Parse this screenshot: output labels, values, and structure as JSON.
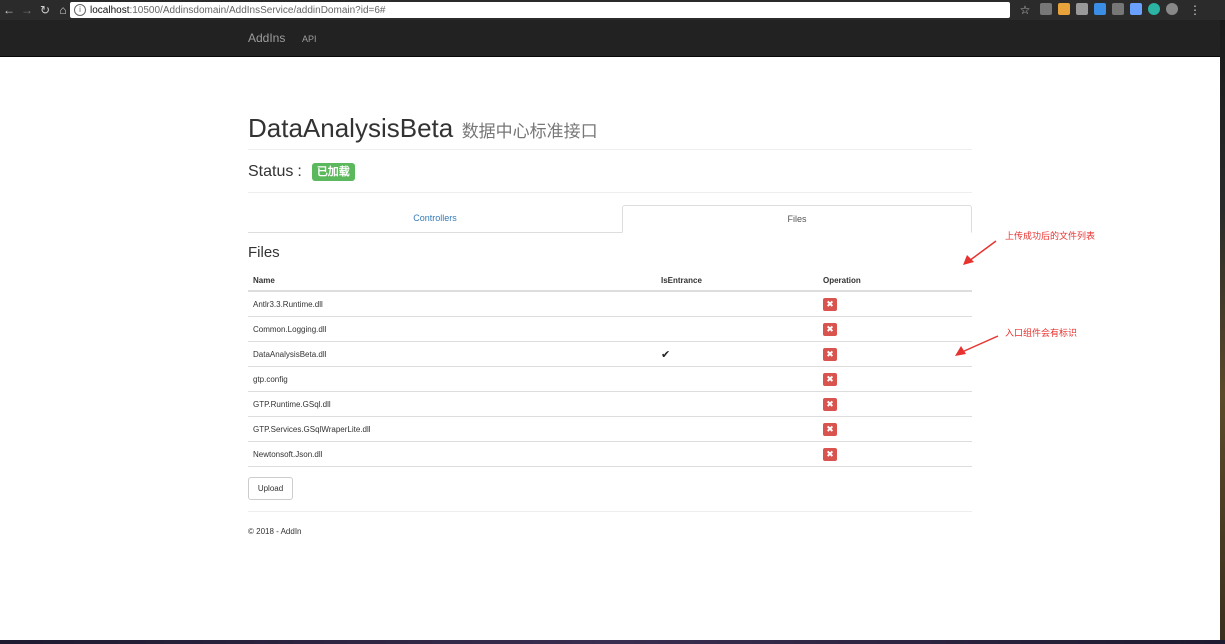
{
  "browser": {
    "url_host": "localhost",
    "url_path": ":10500/Addinsdomain/AddInsService/addinDomain?id=6#",
    "back_icon": "arrow-left-icon",
    "forward_icon": "arrow-right-icon",
    "reload_icon": "reload-icon",
    "home_icon": "home-icon"
  },
  "navbar": {
    "brand": "AddIns",
    "links": [
      "API"
    ]
  },
  "page": {
    "title": "DataAnalysisBeta",
    "subtitle": "数据中心标准接口",
    "status_label": "Status",
    "status_sep": ":",
    "status_badge": "已加载",
    "status_color": "#5cb85c"
  },
  "tabs": [
    {
      "label": "Controllers",
      "active": false
    },
    {
      "label": "Files",
      "active": true
    }
  ],
  "files_section": {
    "title": "Files",
    "columns": [
      "Name",
      "IsEntrance",
      "Operation"
    ],
    "rows": [
      {
        "name": "Antlr3.3.Runtime.dll",
        "entrance": ""
      },
      {
        "name": "Common.Logging.dll",
        "entrance": ""
      },
      {
        "name": "DataAnalysisBeta.dll",
        "entrance": "✔"
      },
      {
        "name": "gtp.config",
        "entrance": ""
      },
      {
        "name": "GTP.Runtime.GSql.dll",
        "entrance": ""
      },
      {
        "name": "GTP.Services.GSqlWraperLite.dll",
        "entrance": ""
      },
      {
        "name": "Newtonsoft.Json.dll",
        "entrance": ""
      }
    ],
    "delete_icon": "remove-icon",
    "delete_color": "#d9534f"
  },
  "upload_label": "Upload",
  "footer": "© 2018 - AddIn",
  "annotations": {
    "files_list": "上传成功后的文件列表",
    "entrance": "入口组件会有标识",
    "color": "#e8322f"
  }
}
